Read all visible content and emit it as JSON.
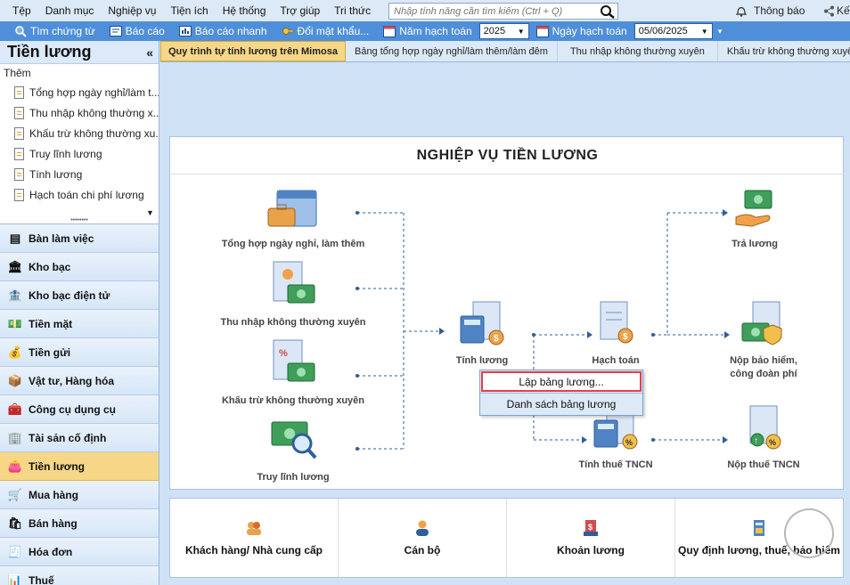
{
  "menu": {
    "items": [
      "Tệp",
      "Danh mục",
      "Nghiệp vụ",
      "Tiện ích",
      "Hệ thống",
      "Trợ giúp",
      "Tri thức"
    ],
    "search_placeholder": "Nhập tính năng cần tìm kiếm (Ctrl + Q)",
    "notify_label": "Thông báo",
    "connect_label": "Kế"
  },
  "toolbar": {
    "find_voucher": "Tìm chứng từ",
    "report": "Báo cáo",
    "quick_report": "Báo cáo nhanh",
    "change_password": "Đổi mật khẩu...",
    "fiscal_year_label": "Năm hạch toán",
    "fiscal_year_value": "2025",
    "posting_date_label": "Ngày hạch toán",
    "posting_date_value": "05/06/2025"
  },
  "sidebar": {
    "title": "Tiền lương",
    "add_label": "Thêm",
    "links": [
      "Tổng hợp ngày nghỉ/làm t...",
      "Thu nhập không thường x...",
      "Khấu trừ không thường xu...",
      "Truy lĩnh lương",
      "Tính lương",
      "Hạch toán chi phí lương"
    ],
    "modules": [
      {
        "label": "Bàn làm việc",
        "icon": "desk-icon"
      },
      {
        "label": "Kho bạc",
        "icon": "treasury-icon"
      },
      {
        "label": "Kho bạc điện tử",
        "icon": "e-treasury-icon"
      },
      {
        "label": "Tiền mặt",
        "icon": "cash-icon"
      },
      {
        "label": "Tiền gửi",
        "icon": "deposit-icon"
      },
      {
        "label": "Vật tư, Hàng hóa",
        "icon": "goods-icon"
      },
      {
        "label": "Công cụ dụng cụ",
        "icon": "tools-icon"
      },
      {
        "label": "Tài sản cố định",
        "icon": "assets-icon"
      },
      {
        "label": "Tiền lương",
        "icon": "salary-icon",
        "active": true
      },
      {
        "label": "Mua hàng",
        "icon": "purchase-icon"
      },
      {
        "label": "Bán hàng",
        "icon": "sales-icon"
      },
      {
        "label": "Hóa đơn",
        "icon": "invoice-icon"
      },
      {
        "label": "Thuế",
        "icon": "tax-icon"
      }
    ]
  },
  "tabs": [
    "Quy trình tự tính lương trên Mimosa",
    "Bảng tổng hợp ngày nghỉ/làm thêm/làm đêm",
    "Thu nhập không thường xuyên",
    "Khấu trừ không thường xuyên"
  ],
  "process": {
    "title": "NGHIỆP VỤ TIỀN LƯƠNG",
    "nodes": {
      "leave": "Tổng hợp ngày nghỉ, làm thêm",
      "irregular_income": "Thu nhập không thường xuyên",
      "irregular_deduction": "Khấu trừ không thường xuyên",
      "back_pay": "Truy lĩnh lương",
      "calc_salary": "Tính lương",
      "posting": "Hạch toán",
      "pay_salary": "Trả lương",
      "insurance": "Nộp bảo hiểm,\ncông đoàn phí",
      "calc_pit": "Tính thuế TNCN",
      "pay_pit": "Nộp thuế TNCN"
    },
    "context_menu": [
      "Lập bảng lương...",
      "Danh sách bảng lương"
    ]
  },
  "shortcuts": [
    {
      "label": "Khách hàng/ Nhà cung cấp",
      "icon": "partners-icon"
    },
    {
      "label": "Cán bộ",
      "icon": "staff-icon"
    },
    {
      "label": "Khoản lương",
      "icon": "salary-item-icon"
    },
    {
      "label": "Quy định lương, thuế, bảo hiểm",
      "icon": "regulation-icon"
    }
  ],
  "colors": {
    "toolbar": "#4f8fd9",
    "active_module": "#f6d787",
    "highlight_border": "#e2404a"
  }
}
